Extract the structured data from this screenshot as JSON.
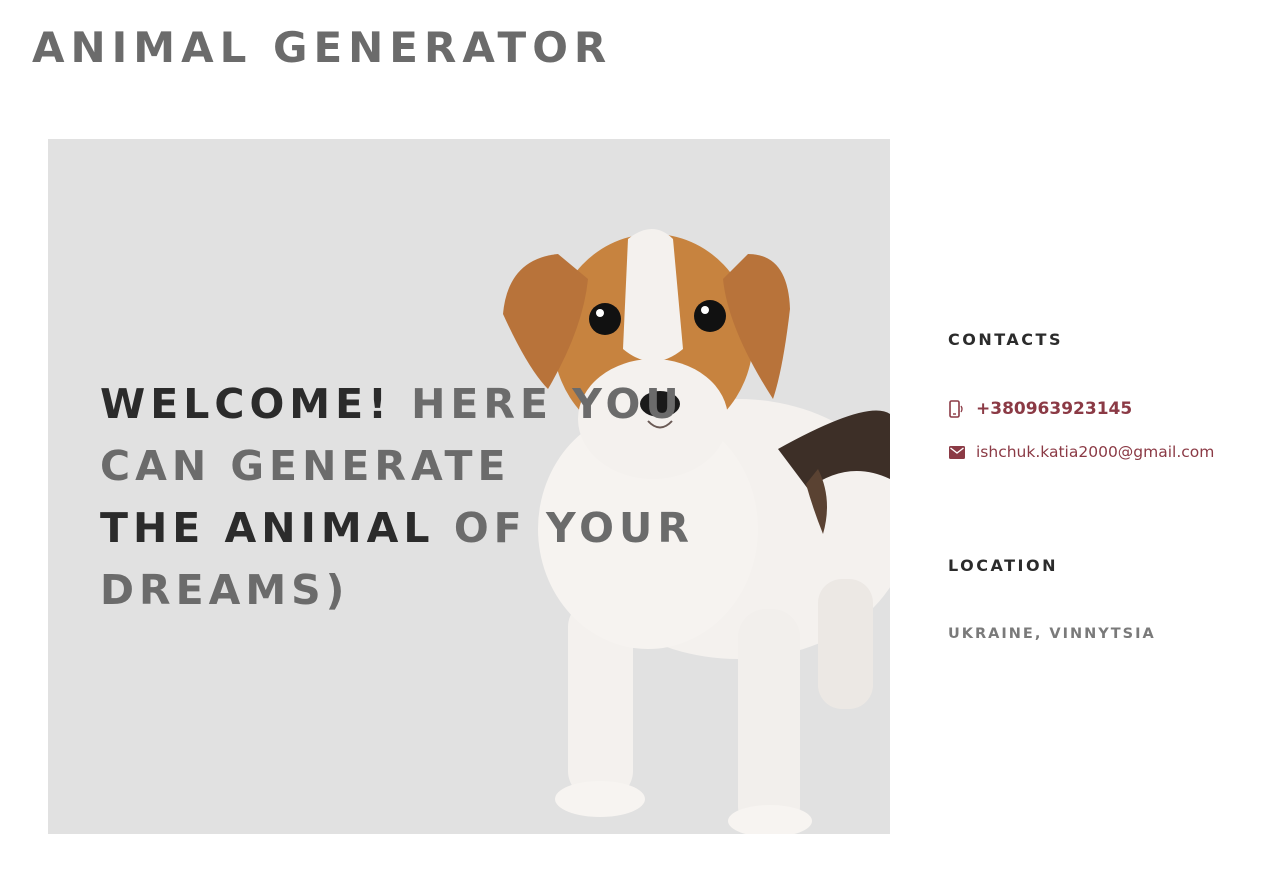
{
  "header": {
    "site_title": "ANIMAL GENERATOR"
  },
  "hero": {
    "line1_dark": "WELCOME!",
    "line1_grey": "HERE YOU",
    "line2_grey": "CAN GENERATE",
    "line3_dark": "THE ANIMAL",
    "line3_grey": "OF YOUR",
    "line4_grey": "DREAMS)",
    "image_icon": "puppy-image",
    "background_color": "#e1e1e1"
  },
  "sidebar": {
    "contacts_heading": "CONTACTS",
    "phone": "+380963923145",
    "phone_icon": "phone-icon",
    "email": "ishchuk.katia2000@gmail.com",
    "email_icon": "mail-icon",
    "location_heading": "LOCATION",
    "location": "UKRAINE, VINNYTSIA",
    "accent_color": "#8b3a45"
  }
}
